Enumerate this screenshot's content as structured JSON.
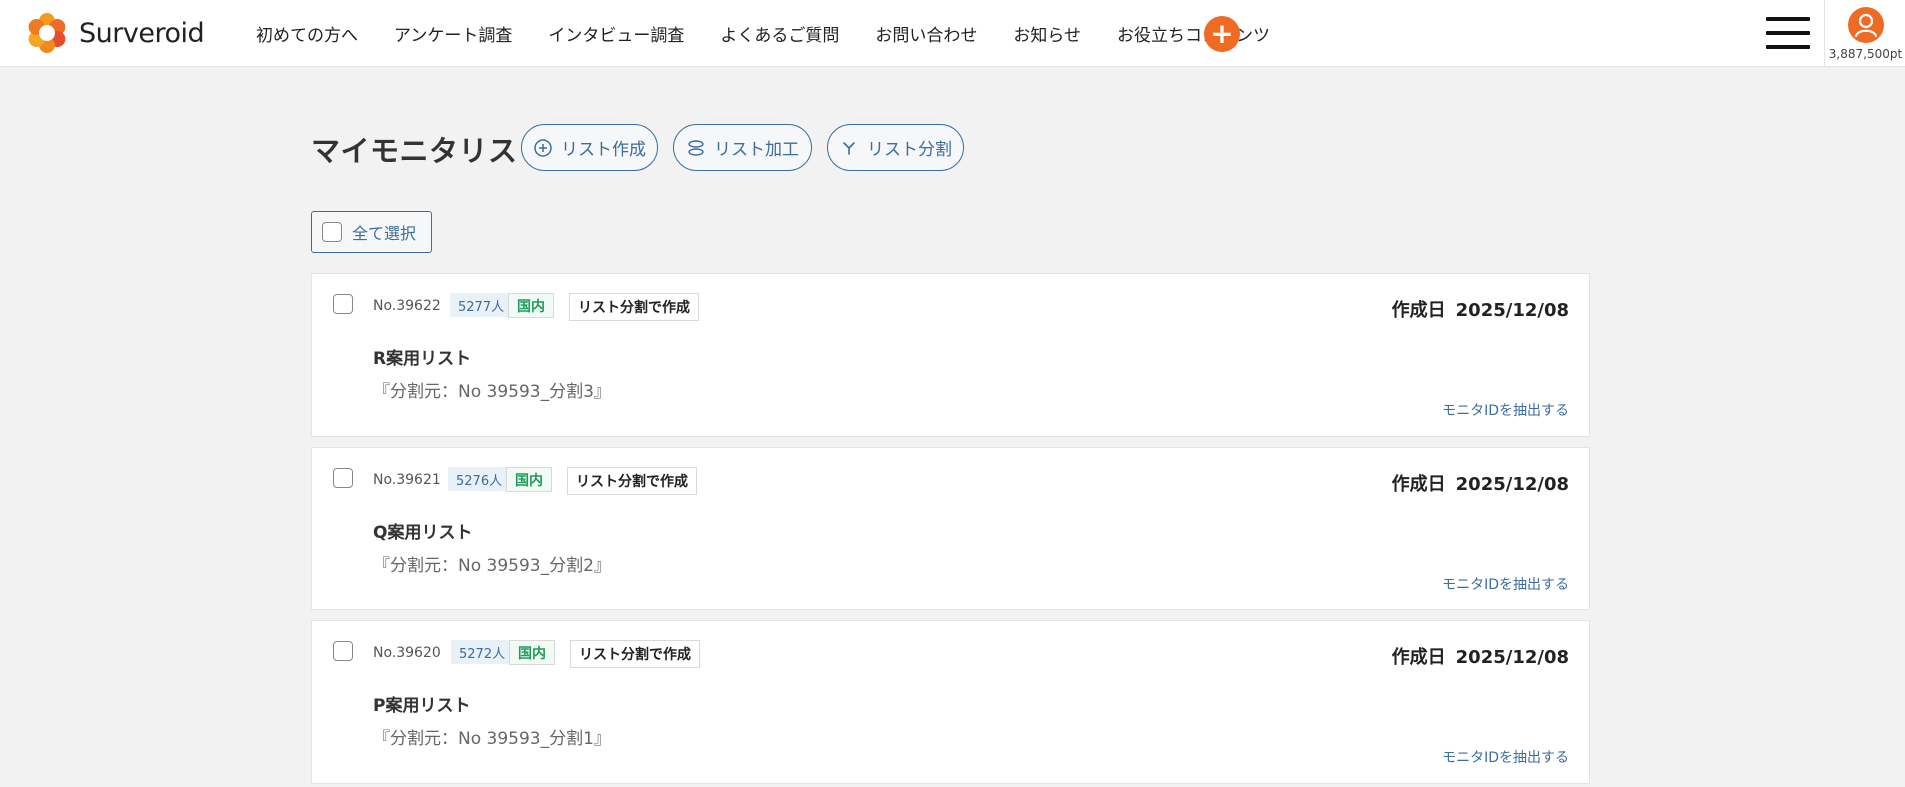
{
  "header": {
    "logo_text": "Surveroid",
    "nav": [
      "初めての方へ",
      "アンケート調査",
      "インタビュー調査",
      "よくあるご質問",
      "お問い合わせ",
      "お知らせ",
      "お役立ちコンテンツ"
    ],
    "plus_label": "+",
    "points": "3,887,500pt",
    "accent_color": "#ef6a23"
  },
  "page": {
    "title": "マイモニタリスト",
    "buttons": {
      "create": "リスト作成",
      "process": "リスト加工",
      "split": "リスト分割"
    },
    "select_all": "全て選択"
  },
  "labels": {
    "created": "作成日",
    "extract": "モニタIDを抽出する"
  },
  "lists": [
    {
      "no": "No.39622",
      "count": "5277人",
      "region": "国内",
      "method": "リスト分割で作成",
      "date": "2025/12/08",
      "name": "R案用リスト",
      "source": "『分割元：No 39593_分割3』"
    },
    {
      "no": "No.39621",
      "count": "5276人",
      "region": "国内",
      "method": "リスト分割で作成",
      "date": "2025/12/08",
      "name": "Q案用リスト",
      "source": "『分割元：No 39593_分割2』"
    },
    {
      "no": "No.39620",
      "count": "5272人",
      "region": "国内",
      "method": "リスト分割で作成",
      "date": "2025/12/08",
      "name": "P案用リスト",
      "source": "『分割元：No 39593_分割1』"
    }
  ]
}
